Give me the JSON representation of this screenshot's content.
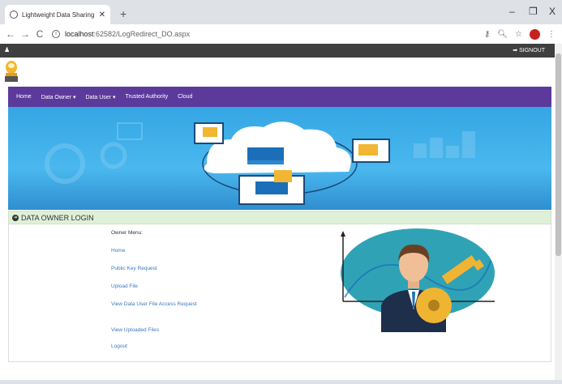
{
  "browser": {
    "tab_title": "Lightweight Data Sharing Schem",
    "new_tab": "+",
    "url_host": "localhost",
    "url_path": ":62582/LogRedirect_DO.aspx",
    "min": "–",
    "max": "❐",
    "close": "X"
  },
  "site": {
    "signout": "SIGNOUT",
    "menu": [
      "Home",
      "Data Owner ▾",
      "Data User ▾",
      "Trusted Authority",
      "Cloud"
    ],
    "section_title": "DATA OWNER LOGIN",
    "owner_menu": {
      "heading": "Owner Menu:",
      "items": [
        "Home",
        "Public Key Request",
        "Upload File",
        "View Data User File Access Request",
        "View Uploaded Files",
        "Logout"
      ]
    }
  },
  "colors": {
    "menubar": "#5b3a9c",
    "section_bg": "#dff0d8",
    "link": "#3a7abf",
    "topbar": "#3f3f3f"
  }
}
